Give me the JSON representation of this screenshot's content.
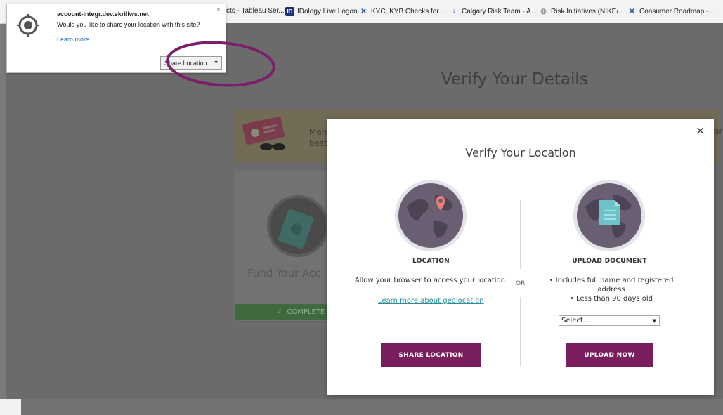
{
  "bookmarks": [
    {
      "label": "cts - Tableau Ser...",
      "icon": "tableau-icon"
    },
    {
      "label": "IDology Live Logon",
      "icon": "idology-icon"
    },
    {
      "label": "KYC, KYB Checks for ...",
      "icon": "k-icon"
    },
    {
      "label": "Calgary Risk Team - A...",
      "icon": "bulb-icon"
    },
    {
      "label": "Risk Initiatives (NIKE/...",
      "icon": "globe-icon"
    },
    {
      "label": "Consumer Roadmap -...",
      "icon": "k-icon"
    }
  ],
  "background": {
    "title": "Verify Your Details",
    "banner_line1": "Men",
    "banner_line2": "best",
    "banner_right": "ar",
    "card_title": "Fund Your Acc",
    "completed_label": "COMPLETE"
  },
  "permission_popup": {
    "domain": "account-integr.dev.skrillws.net",
    "question": "Would you like to share your location with this site?",
    "learn_more": "Learn more...",
    "share_button": "Share Location",
    "close": "×"
  },
  "modal": {
    "title": "Verify Your Location",
    "close": "×",
    "location": {
      "heading": "LOCATION",
      "text": "Allow your browser to access your location.",
      "learn_link": "Learn more about geolocation",
      "button": "SHARE LOCATION"
    },
    "or_label": "OR",
    "upload": {
      "heading": "UPLOAD DOCUMENT",
      "bullet1_line1": "• Includes full name and registered",
      "bullet1_line2": "address",
      "bullet2": "• Less than 90 days old",
      "select_value": "Select...",
      "button": "UPLOAD NOW"
    }
  },
  "colors": {
    "brand": "#7a1e5e",
    "link": "#2a8f9a",
    "pin": "#f07f7a",
    "document": "#6cc4c8",
    "annotation": "#7b1f6b"
  }
}
